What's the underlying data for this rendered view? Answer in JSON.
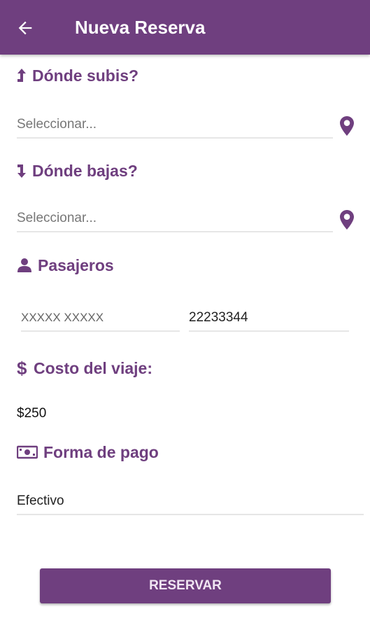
{
  "header": {
    "title": "Nueva Reserva",
    "back_icon": "arrow-left-icon",
    "background": "#6f3f7f"
  },
  "origin": {
    "label": "Dónde subis?",
    "icon": "arrow-up-icon",
    "placeholder": "Seleccionar...",
    "pin_icon": "map-marker-icon"
  },
  "destination": {
    "label": "Dónde bajas?",
    "icon": "arrow-down-icon",
    "placeholder": "Seleccionar...",
    "pin_icon": "map-marker-icon"
  },
  "passengers": {
    "label": "Pasajeros",
    "icon": "user-icon",
    "name_value": "XXXXX XXXXX",
    "document_value": "22233344"
  },
  "cost": {
    "label": "Costo del viaje:",
    "icon": "dollar-icon",
    "value": "$250"
  },
  "payment": {
    "label": "Forma de pago",
    "icon": "money-bill-icon",
    "value": "Efectivo"
  },
  "actions": {
    "reserve_label": "RESERVAR"
  },
  "colors": {
    "accent": "#6f3f7f"
  }
}
